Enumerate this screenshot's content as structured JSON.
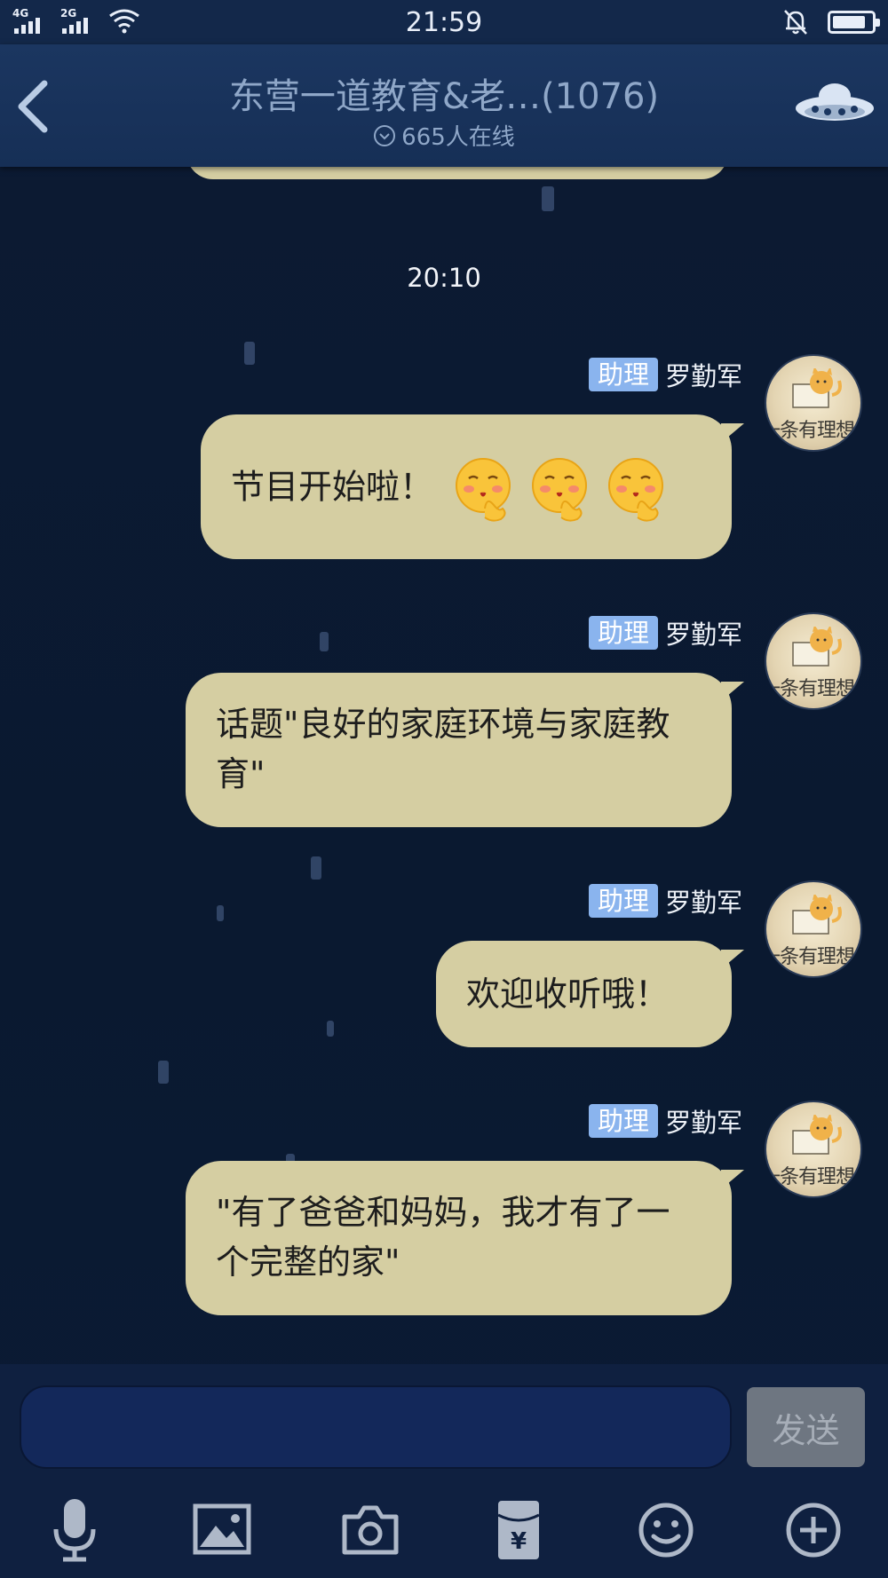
{
  "status_bar": {
    "sim1_network": "4G",
    "sim2_network": "2G",
    "time": "21:59"
  },
  "header": {
    "title": "东营一道教育&老…(1076)",
    "online": "665人在线"
  },
  "time_separator": "20:10",
  "messages": [
    {
      "badge": "助理",
      "sender": "罗勤军",
      "text": "节目开始啦！",
      "emojis": [
        "shy-face-emoji",
        "shy-face-emoji",
        "shy-face-emoji"
      ]
    },
    {
      "badge": "助理",
      "sender": "罗勤军",
      "text": "话题\"良好的家庭环境与家庭教育\""
    },
    {
      "badge": "助理",
      "sender": "罗勤军",
      "text": "欢迎收听哦！"
    },
    {
      "badge": "助理",
      "sender": "罗勤军",
      "text": "\"有了爸爸和妈妈，我才有了一个完整的家\""
    }
  ],
  "avatar_text": "一条有理想的咸鱼",
  "input": {
    "value": "",
    "send_label": "发送"
  },
  "toolbar": [
    "microphone-icon",
    "image-icon",
    "camera-icon",
    "red-packet-icon",
    "emoji-icon",
    "plus-icon"
  ],
  "colors": {
    "bubble": "#d5cea2",
    "badge": "#8ab4ee",
    "header": "#1b3660",
    "background": "#0b1830"
  }
}
